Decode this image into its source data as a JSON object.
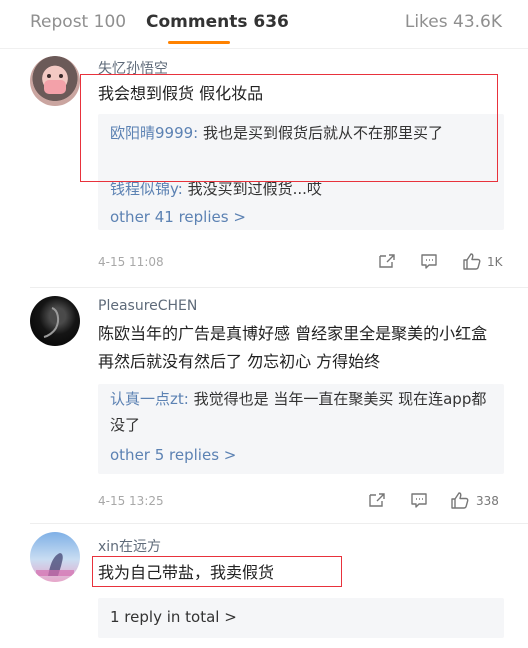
{
  "tabs": {
    "repost": "Repost 100",
    "comments": "Comments 636",
    "likes": "Likes 43.6K"
  },
  "comments": [
    {
      "user": "失忆孙悟空",
      "text": "我会想到假货 假化妆品",
      "replies": [
        {
          "name": "欧阳晴9999:",
          "text": " 我也是买到假货后就从不在那里买了"
        },
        {
          "name": "钱程似锦y:",
          "text": " 我没买到过假货...哎"
        }
      ],
      "more": "other 41 replies >",
      "time": "4-15 11:08",
      "likes": "1K"
    },
    {
      "user": "PleasureCHEN",
      "text": "陈欧当年的广告是真博好感 曾经家里全是聚美的小红盒  再然后就没有然后了  勿忘初心 方得始终",
      "replies": [
        {
          "name": "认真一点zt:",
          "text": " 我觉得也是 当年一直在聚美买 现在连app都没了"
        }
      ],
      "more": "other 5 replies >",
      "time": "4-15 13:25",
      "likes": "338"
    },
    {
      "user": "xin在远方",
      "text": "我为自己带盐，我卖假货",
      "more": "1 reply in total >"
    }
  ],
  "colors": {
    "accent": "#ff8200",
    "link": "#5c82b3",
    "highlight": "#e8323c"
  },
  "icons": [
    "share-icon",
    "comment-icon",
    "like-icon"
  ]
}
